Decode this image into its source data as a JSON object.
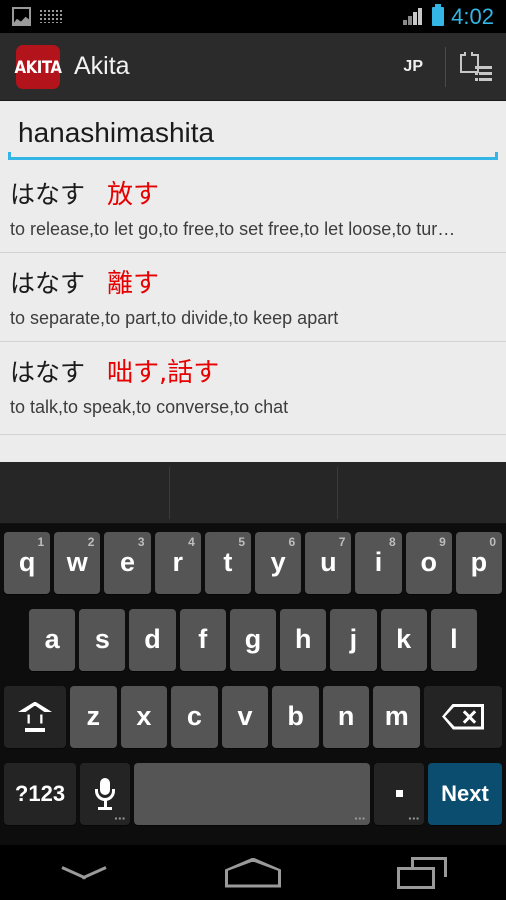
{
  "status_bar": {
    "icons": [
      "screenshot-icon",
      "keyboard-icon",
      "signal-icon",
      "battery-icon"
    ],
    "time": "4:02",
    "time_color": "#33b5e5"
  },
  "app_bar": {
    "logo_text": "AKITA",
    "logo_color": "#b3131a",
    "title": "Akita",
    "language_button": "JP",
    "action_icon": "word-list-icon"
  },
  "search": {
    "value": "hanashimashita",
    "placeholder": "",
    "underline_color": "#33b5e5"
  },
  "results": [
    {
      "kana": "はなす",
      "kanji": "放す",
      "definition": "to release,to let go,to free,to set free,to let loose,to tur…"
    },
    {
      "kana": "はなす",
      "kanji": "離す",
      "definition": "to separate,to part,to divide,to keep apart"
    },
    {
      "kana": "はなす",
      "kanji": "咄す,話す",
      "definition": "to talk,to speak,to converse,to chat"
    }
  ],
  "result_kanji_color": "#e60000",
  "keyboard": {
    "suggestions": [
      "",
      "",
      ""
    ],
    "row1": [
      {
        "label": "q",
        "sup": "1"
      },
      {
        "label": "w",
        "sup": "2"
      },
      {
        "label": "e",
        "sup": "3"
      },
      {
        "label": "r",
        "sup": "4"
      },
      {
        "label": "t",
        "sup": "5"
      },
      {
        "label": "y",
        "sup": "6"
      },
      {
        "label": "u",
        "sup": "7"
      },
      {
        "label": "i",
        "sup": "8"
      },
      {
        "label": "o",
        "sup": "9"
      },
      {
        "label": "p",
        "sup": "0"
      }
    ],
    "row2": [
      {
        "label": "a"
      },
      {
        "label": "s"
      },
      {
        "label": "d"
      },
      {
        "label": "f"
      },
      {
        "label": "g"
      },
      {
        "label": "h"
      },
      {
        "label": "j"
      },
      {
        "label": "k"
      },
      {
        "label": "l"
      }
    ],
    "row3": [
      {
        "label": "z"
      },
      {
        "label": "x"
      },
      {
        "label": "c"
      },
      {
        "label": "v"
      },
      {
        "label": "b"
      },
      {
        "label": "n"
      },
      {
        "label": "m"
      }
    ],
    "shift_icon": "shift-icon",
    "backspace_icon": "backspace-icon",
    "symbols_label": "?123",
    "mic_icon": "microphone-icon",
    "space_label": "",
    "period_label": ".",
    "enter_label": "Next",
    "enter_color": "#0a4d6e"
  },
  "nav_bar": {
    "back_icon": "hide-keyboard-icon",
    "home_icon": "home-icon",
    "recents_icon": "recents-icon"
  }
}
